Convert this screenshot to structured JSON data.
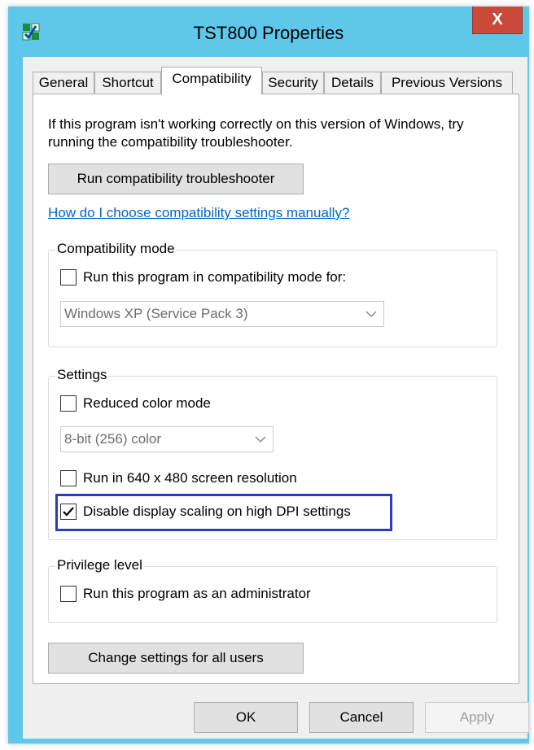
{
  "window": {
    "title": "TST800 Properties",
    "close_label": "X"
  },
  "tabs": [
    {
      "label": "General"
    },
    {
      "label": "Shortcut"
    },
    {
      "label": "Compatibility",
      "active": true
    },
    {
      "label": "Security"
    },
    {
      "label": "Details"
    },
    {
      "label": "Previous Versions"
    }
  ],
  "compat": {
    "intro": "If this program isn't working correctly on this version of Windows, try running the compatibility troubleshooter.",
    "troubleshooter_button": "Run compatibility troubleshooter",
    "help_link": "How do I choose compatibility settings manually?"
  },
  "compat_mode": {
    "group_label": "Compatibility mode",
    "checkbox_label": "Run this program in compatibility mode for:",
    "checked": false,
    "os_select": "Windows XP (Service Pack 3)"
  },
  "settings": {
    "group_label": "Settings",
    "reduced_color_label": "Reduced color mode",
    "reduced_color_checked": false,
    "color_select": "8-bit (256) color",
    "resolution_label": "Run in 640 x 480 screen resolution",
    "resolution_checked": false,
    "dpi_label": "Disable display scaling on high DPI settings",
    "dpi_checked": true
  },
  "privilege": {
    "group_label": "Privilege level",
    "admin_label": "Run this program as an administrator",
    "admin_checked": false
  },
  "all_users_button": "Change settings for all users",
  "dialog_buttons": {
    "ok": "OK",
    "cancel": "Cancel",
    "apply": "Apply"
  },
  "colors": {
    "title_bar": "#5ec7ea",
    "close_button": "#c94a3a",
    "highlight_border": "#2a3fb5",
    "link": "#0066cc"
  }
}
